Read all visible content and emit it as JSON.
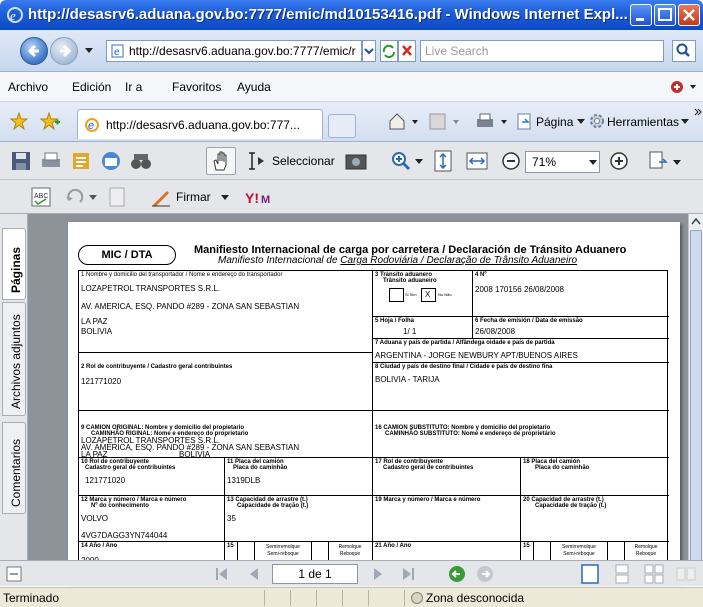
{
  "window": {
    "title": "http://desasrv6.aduana.gov.bo:7777/emic/md10153416.pdf - Windows Internet Expl..."
  },
  "address_bar": {
    "url": "http://desasrv6.aduana.gov.bo:7777/emic/r",
    "search_placeholder": "Live Search"
  },
  "menu": {
    "items": [
      "Archivo",
      "Edición",
      "Ir a",
      "Favoritos",
      "Ayuda"
    ]
  },
  "tabs": {
    "active_tab": "http://desasrv6.aduana.gov.bo:777...",
    "page_label": "Página",
    "tools_label": "Herramientas"
  },
  "pdf_toolbar": {
    "select_label": "Seleccionar",
    "zoom": "71%",
    "sign_label": "Firmar"
  },
  "left_panel": {
    "tabs": [
      "Páginas",
      "Archivos adjuntos",
      "Comentarios"
    ]
  },
  "document": {
    "badge": "MIC / DTA",
    "title_es": "Manifiesto Internacional de carga por carretera / Declaración de Tránsito Aduanero",
    "title_pt_prefix": "Manifiesto Internacional de ",
    "title_pt_underlined": "Carga Rodoviária / Declaração de Trânsito Aduaneiro",
    "f1_label": "1 Nombre y domicilio del transportador / Nome e endereço do transportador",
    "f1_name": "LOZAPETROL TRANSPORTES S.R.L.",
    "f1_addr": "AV. AMERICA, ESQ. PANDO #289 - ZONA SAN SEBASTIAN",
    "f1_city": "LA PAZ",
    "f1_country": "BOLIVIA",
    "f3_label": "3 Tránsito aduanero",
    "f3_label2": "Trânsito aduaneiro",
    "f3_si": "Si Sim",
    "f3_x": "X",
    "f3_no": "No Não",
    "f4_label": "4 Nº",
    "f4_value": "2008  170156  26/08/2008",
    "f5_label": "5 Hoja / Folha",
    "f5_value": "1/  1",
    "f6_label": "6 Fecha de emisión / Data de emissão",
    "f6_value": "26/08/2008",
    "f7_label": "7 Aduana y país de partida / Alfândega oidade e país de partida",
    "f7_value": "ARGENTINA - JORGE NEWBURY APT/BUENOS AIRES",
    "f2_label": "2 Rol de contribuyente / Cadastro geral contribuintes",
    "f2_value": "121771020",
    "f8_label": "8 Ciudad y país de destino final / Cidade e país de destino fina",
    "f8_value": "BOLIVIA - TARIJA",
    "f9_label1": "9 CAMION ORIGINAL: Nombre y domicilio del propietario",
    "f9_label2": "CAMINHÃO RIGINAL: Nome e endereço do proprietario",
    "f9_name": "LOZAPETROL TRANSPORTES S.R.L.",
    "f9_addr": "AV. AMERICA, ESQ. PANDO #289 - ZONA SAN SEBASTIAN",
    "f9_city": "LA PAZ",
    "f9_country": "BOLIVIA",
    "f16_label1": "16 CAMION SUBSTITUTO: Nombre y domicilio del propietario",
    "f16_label2": "CAMINHÃO SUBSTITUTO: Nome e endereço de proprietário",
    "f10_label1": "10 Rol de contribuyente",
    "f10_label2": "Cadastro geral de contribuintes",
    "f10_value": "121771020",
    "f11_label1": "11 Placa del camión",
    "f11_label2": "Placa do caminhão",
    "f11_value": "1319DLB",
    "f17_label1": "17 Rol de contribuyente",
    "f17_label2": "Cadastro geral de contribuintes",
    "f18_label1": "18 Placa del camión",
    "f18_label2": "Placa do caminhão",
    "f12_label1": "12 Marca y número / Marca e número",
    "f12_label2": "Nº do conhecimento",
    "f12_value1": "VOLVO",
    "f12_value2": "4VG7DAGG3YN744044",
    "f13_label1": "13 Capacidad de arrastre (t.)",
    "f13_label2": "Capacidade de tração (t.)",
    "f13_value": "35",
    "f19_label": "19 Marca y número / Marca e número",
    "f20_label1": "20 Capacidad de arrastre (t.)",
    "f20_label2": "Capacidade de tração (t.)",
    "f14_label": "14 Año / Ano",
    "f14_value": "2000",
    "f15_label": "15",
    "f15_semi": "Semirremolque Semi-reboque",
    "f15_rem": "Remolque Reboque",
    "f15_extra": "null",
    "f21_label": "21 Año / Ano",
    "f15b_label": "15",
    "f15b_semi": "Semirremolque Semi-reboque",
    "f15b_rem": "Remolque Reboque"
  },
  "pdf_nav": {
    "page": "1 de 1"
  },
  "status": {
    "left": "Terminado",
    "zone": "Zona desconocida"
  }
}
